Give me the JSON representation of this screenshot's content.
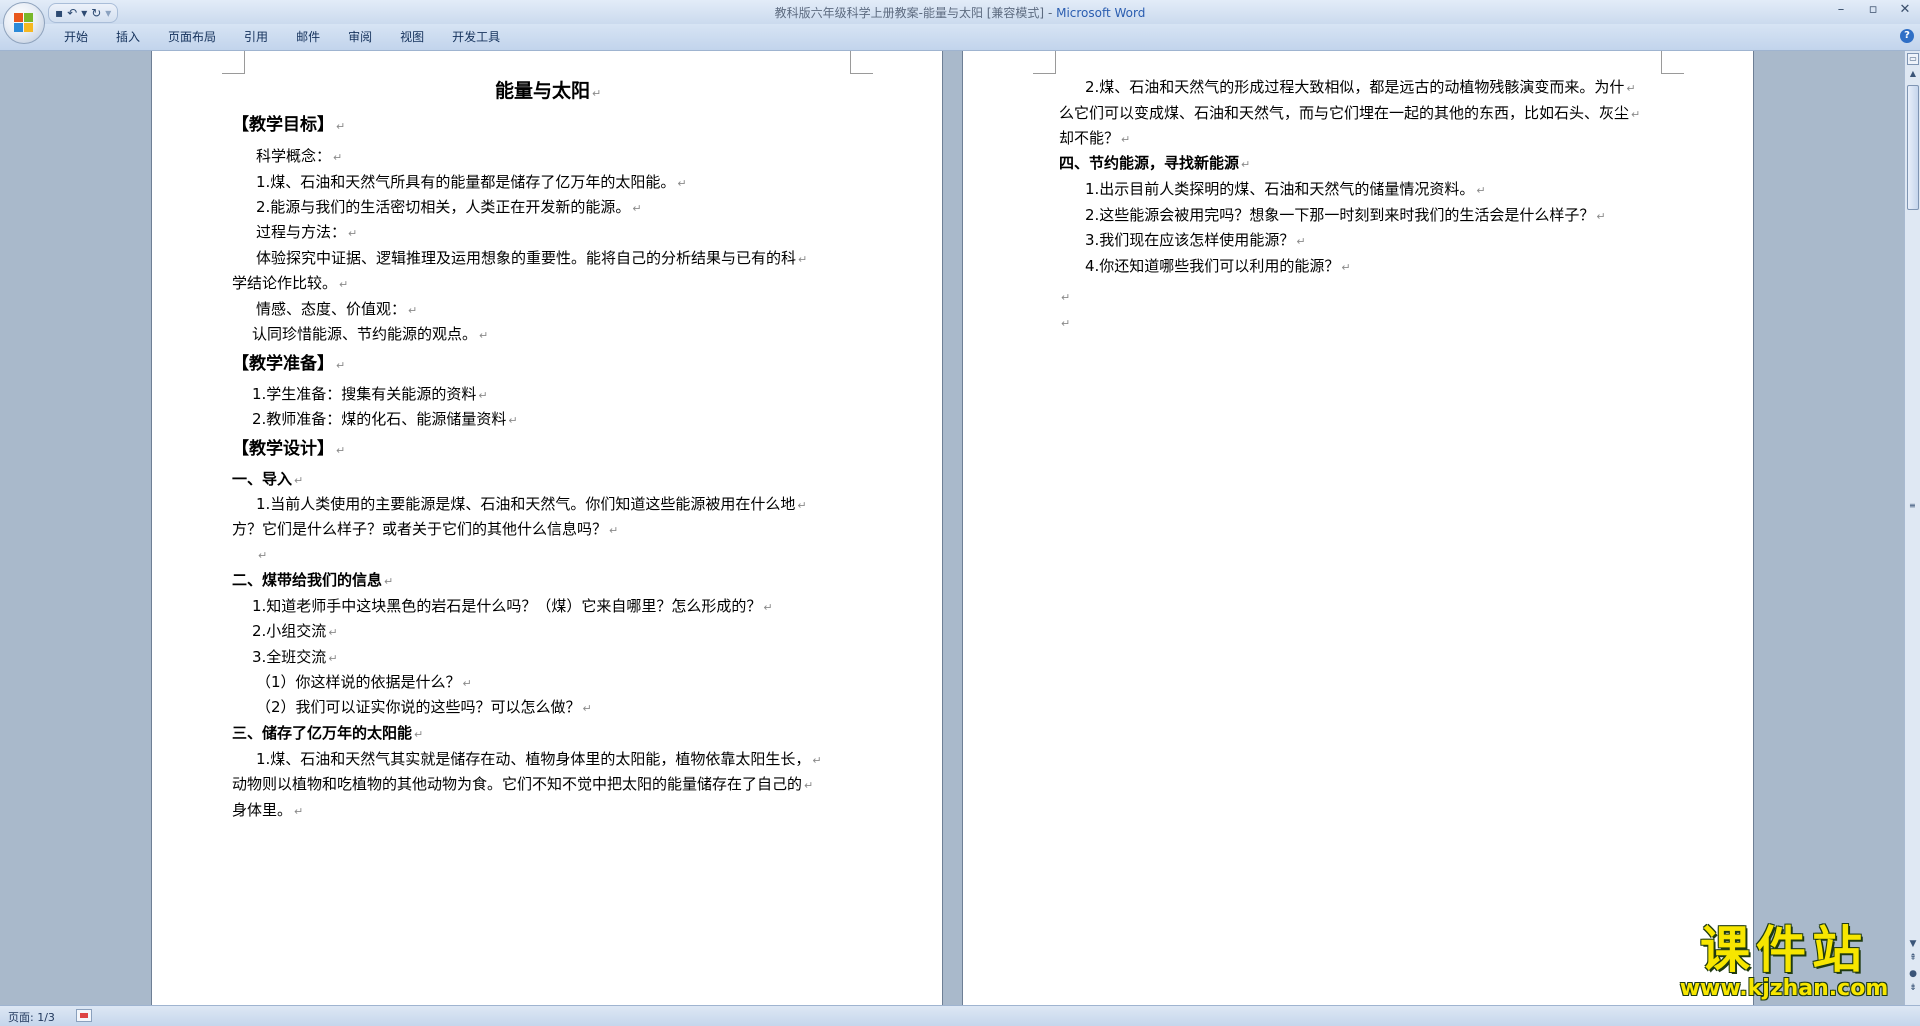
{
  "window": {
    "title": "教科版六年级科学上册教案-能量与太阳 [兼容模式]",
    "title_sep": " - ",
    "app_name": "Microsoft Word",
    "controls": {
      "minimize": "–",
      "maximize": "▫",
      "close": "✕"
    }
  },
  "quick_access": {
    "save": "▪",
    "undo": "↶",
    "undo_dropdown": "▾",
    "redo": "↻",
    "customize": "▾"
  },
  "ribbon": {
    "tabs": [
      "开始",
      "插入",
      "页面布局",
      "引用",
      "邮件",
      "审阅",
      "视图",
      "开发工具"
    ],
    "help": "?"
  },
  "pages": {
    "page1": [
      {
        "text": "能量与太阳",
        "style": "title"
      },
      {
        "text": "【教学目标】",
        "style": "h"
      },
      {
        "text": "科学概念：",
        "style": "p"
      },
      {
        "text": "1.煤、石油和天然气所具有的能量都是储存了亿万年的太阳能。",
        "style": "p"
      },
      {
        "text": "2.能源与我们的生活密切相关，人类正在开发新的能源。",
        "style": "p"
      },
      {
        "text": "过程与方法：",
        "style": "p"
      },
      {
        "text": "体验探究中证据、逻辑推理及运用想象的重要性。能将自己的分析结果与已有的科",
        "style": "p"
      },
      {
        "text": "学结论作比较。",
        "style": "p"
      },
      {
        "text": "情感、态度、价值观：",
        "style": "p"
      },
      {
        "text": "认同珍惜能源、节约能源的观点。",
        "style": "p"
      },
      {
        "text": "【教学准备】",
        "style": "h"
      },
      {
        "text": "1.学生准备：搜集有关能源的资料",
        "style": "p"
      },
      {
        "text": "2.教师准备：煤的化石、能源储量资料",
        "style": "p"
      },
      {
        "text": "【教学设计】",
        "style": "h"
      },
      {
        "text": "一、导入",
        "style": "b"
      },
      {
        "text": "1.当前人类使用的主要能源是煤、石油和天然气。你们知道这些能源被用在什么地",
        "style": "p"
      },
      {
        "text": "方？它们是什么样子？或者关于它们的其他什么信息吗？",
        "style": "p"
      },
      {
        "text": "",
        "style": "p"
      },
      {
        "text": "二、煤带给我们的信息",
        "style": "b"
      },
      {
        "text": "1.知道老师手中这块黑色的岩石是什么吗？（煤）它来自哪里？怎么形成的？",
        "style": "p"
      },
      {
        "text": "2.小组交流",
        "style": "p"
      },
      {
        "text": "3.全班交流",
        "style": "p"
      },
      {
        "text": "（1）你这样说的依据是什么？",
        "style": "p"
      },
      {
        "text": "（2）我们可以证实你说的这些吗？可以怎么做？",
        "style": "p"
      },
      {
        "text": "三、储存了亿万年的太阳能",
        "style": "b"
      },
      {
        "text": "1.煤、石油和天然气其实就是储存在动、植物身体里的太阳能，植物依靠太阳生长，",
        "style": "p"
      },
      {
        "text": "动物则以植物和吃植物的其他动物为食。它们不知不觉中把太阳的能量储存在了自己的",
        "style": "p"
      },
      {
        "text": "身体里。",
        "style": "p"
      }
    ],
    "page2": [
      {
        "text": "2.煤、石油和天然气的形成过程大致相似，都是远古的动植物残骸演变而来。为什",
        "style": "p"
      },
      {
        "text": "么它们可以变成煤、石油和天然气，而与它们埋在一起的其他的东西，比如石头、灰尘",
        "style": "p"
      },
      {
        "text": "却不能？",
        "style": "p"
      },
      {
        "text": "四、节约能源，寻找新能源",
        "style": "b"
      },
      {
        "text": "1.出示目前人类探明的煤、石油和天然气的储量情况资料。",
        "style": "p"
      },
      {
        "text": "2.这些能源会被用完吗？想象一下那一时刻到来时我们的生活会是什么样子？",
        "style": "p"
      },
      {
        "text": "3.我们现在应该怎样使用能源？",
        "style": "p"
      },
      {
        "text": "4.你还知道哪些我们可以利用的能源？",
        "style": "p"
      },
      {
        "text": "",
        "style": "p"
      },
      {
        "text": "",
        "style": "p"
      }
    ]
  },
  "paragraph_mark": "↵",
  "statusbar": {
    "page": "页面: 1/3"
  },
  "watermark": {
    "name": "课件站",
    "url": "www.kjzhan.com"
  }
}
